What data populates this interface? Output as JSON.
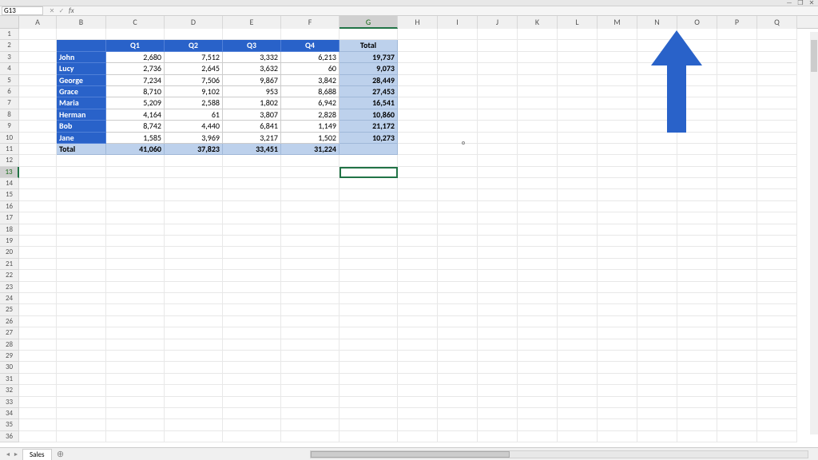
{
  "activeCell": "G13",
  "columns": [
    "A",
    "B",
    "C",
    "D",
    "E",
    "F",
    "G",
    "H",
    "I",
    "J",
    "K",
    "L",
    "M",
    "N",
    "O",
    "P",
    "Q"
  ],
  "rowCount": 36,
  "selectedCol": "G",
  "selectedRow": 13,
  "chart_data": {
    "type": "table",
    "title": "",
    "columns": [
      "",
      "Q1",
      "Q2",
      "Q3",
      "Q4",
      "Total"
    ],
    "rows": [
      {
        "name": "John",
        "q1": "2,680",
        "q2": "7,512",
        "q3": "3,332",
        "q4": "6,213",
        "total": "19,737"
      },
      {
        "name": "Lucy",
        "q1": "2,736",
        "q2": "2,645",
        "q3": "3,632",
        "q4": "60",
        "total": "9,073"
      },
      {
        "name": "George",
        "q1": "7,234",
        "q2": "7,506",
        "q3": "9,867",
        "q4": "3,842",
        "total": "28,449"
      },
      {
        "name": "Grace",
        "q1": "8,710",
        "q2": "9,102",
        "q3": "953",
        "q4": "8,688",
        "total": "27,453"
      },
      {
        "name": "Maria",
        "q1": "5,209",
        "q2": "2,588",
        "q3": "1,802",
        "q4": "6,942",
        "total": "16,541"
      },
      {
        "name": "Herman",
        "q1": "4,164",
        "q2": "61",
        "q3": "3,807",
        "q4": "2,828",
        "total": "10,860"
      },
      {
        "name": "Bob",
        "q1": "8,742",
        "q2": "4,440",
        "q3": "6,841",
        "q4": "1,149",
        "total": "21,172"
      },
      {
        "name": "Jane",
        "q1": "1,585",
        "q2": "3,969",
        "q3": "3,217",
        "q4": "1,502",
        "total": "10,273"
      }
    ],
    "totals": {
      "name": "Total",
      "q1": "41,060",
      "q2": "37,823",
      "q3": "33,451",
      "q4": "31,224",
      "total": ""
    }
  },
  "headers": {
    "blank": "",
    "q1": "Q1",
    "q2": "Q2",
    "q3": "Q3",
    "q4": "Q4",
    "total": "Total"
  },
  "names": [
    "John",
    "Lucy",
    "George",
    "Grace",
    "Maria",
    "Herman",
    "Bob",
    "Jane"
  ],
  "sheetName": "Sales",
  "fx": "fx",
  "windowControls": {
    "min": "—",
    "max": "❐",
    "close": "✕"
  },
  "arrowColor": "#2962c9"
}
